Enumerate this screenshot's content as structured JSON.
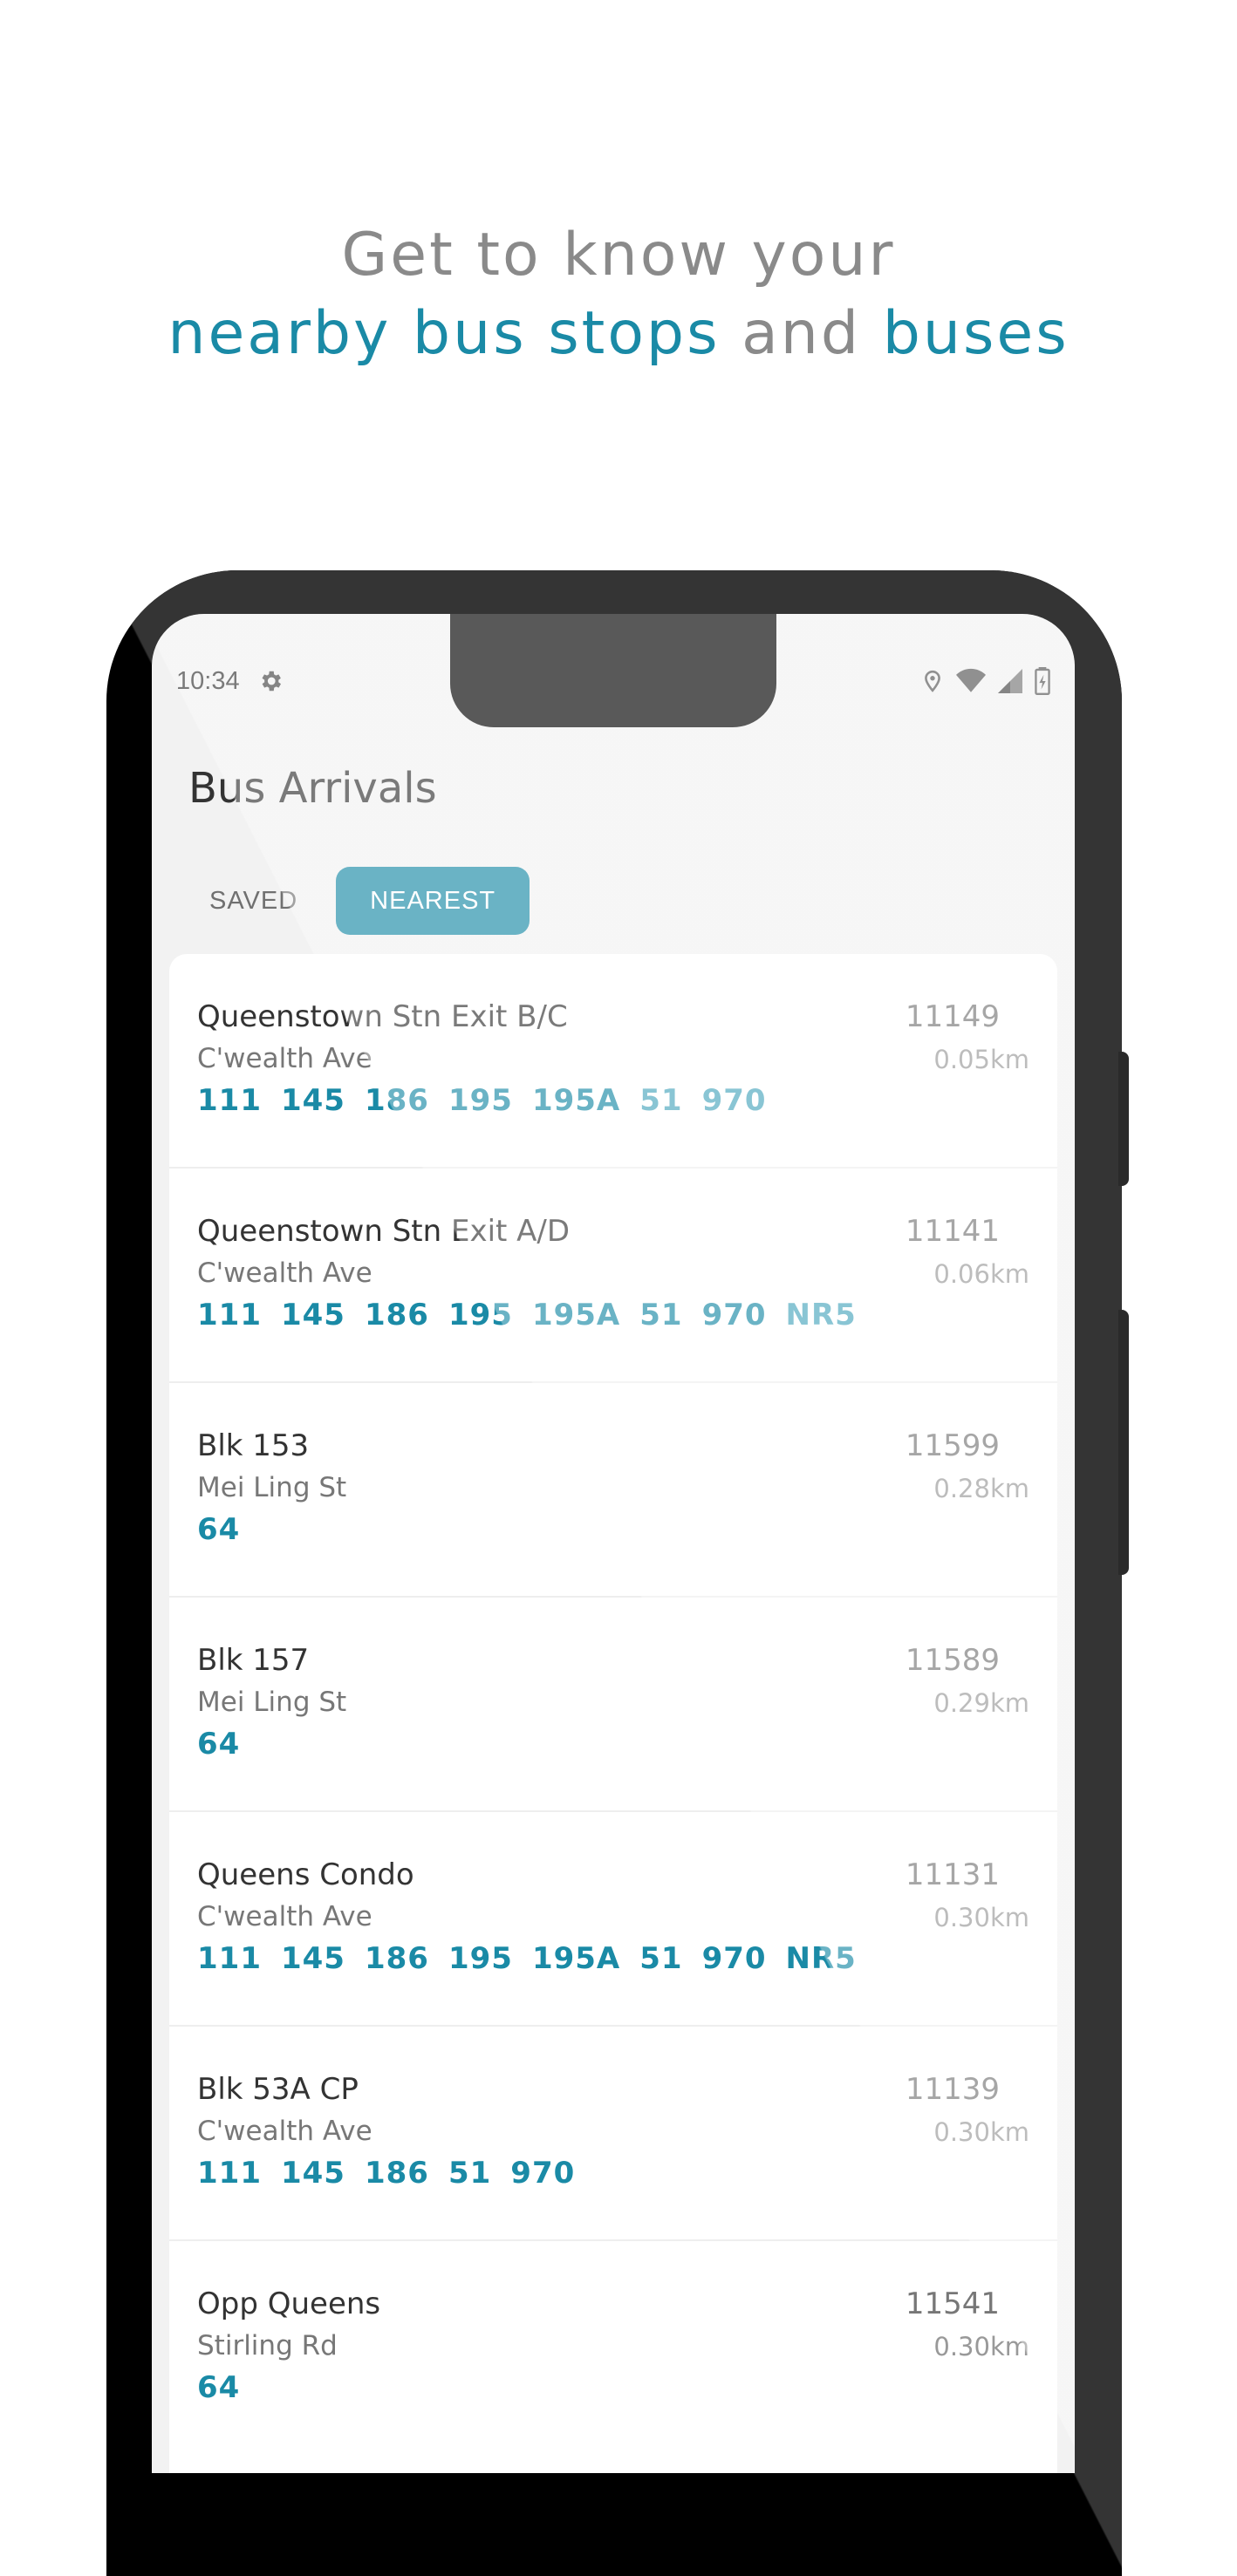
{
  "headline": {
    "line1": "Get to know your",
    "line2_part1": "nearby bus stops",
    "line2_part2": "and",
    "line2_part3": "buses"
  },
  "status_bar": {
    "time": "10:34",
    "icons": [
      "gear-icon",
      "location-icon",
      "wifi-icon",
      "signal-icon",
      "battery-icon"
    ]
  },
  "app": {
    "title": "Bus Arrivals",
    "tabs": [
      {
        "label": "SAVED",
        "active": false
      },
      {
        "label": "NEAREST",
        "active": true
      }
    ]
  },
  "stops": [
    {
      "name": "Queenstown Stn Exit B/C",
      "road": "C'wealth Ave",
      "code": "11149",
      "distance": "0.05km",
      "buses": [
        "111",
        "145",
        "186",
        "195",
        "195A",
        "51",
        "970"
      ]
    },
    {
      "name": "Queenstown Stn Exit A/D",
      "road": "C'wealth Ave",
      "code": "11141",
      "distance": "0.06km",
      "buses": [
        "111",
        "145",
        "186",
        "195",
        "195A",
        "51",
        "970",
        "NR5"
      ]
    },
    {
      "name": "Blk 153",
      "road": "Mei Ling St",
      "code": "11599",
      "distance": "0.28km",
      "buses": [
        "64"
      ]
    },
    {
      "name": "Blk 157",
      "road": "Mei Ling St",
      "code": "11589",
      "distance": "0.29km",
      "buses": [
        "64"
      ]
    },
    {
      "name": "Queens Condo",
      "road": "C'wealth Ave",
      "code": "11131",
      "distance": "0.30km",
      "buses": [
        "111",
        "145",
        "186",
        "195",
        "195A",
        "51",
        "970",
        "NR5"
      ]
    },
    {
      "name": "Blk 53A CP",
      "road": "C'wealth Ave",
      "code": "11139",
      "distance": "0.30km",
      "buses": [
        "111",
        "145",
        "186",
        "51",
        "970"
      ]
    },
    {
      "name": "Opp Queens",
      "road": "Stirling Rd",
      "code": "11541",
      "distance": "0.30km",
      "buses": [
        "64"
      ]
    }
  ],
  "colors": {
    "accent": "#1a8aa6",
    "text": "#333333",
    "muted": "#777777"
  }
}
